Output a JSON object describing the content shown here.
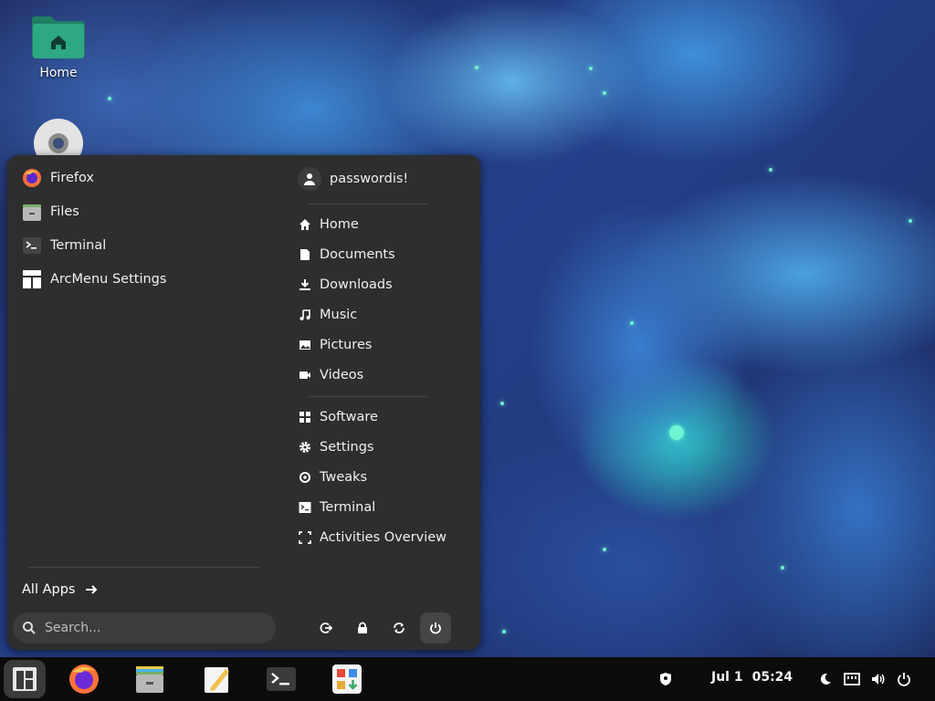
{
  "desktop": {
    "icons": [
      {
        "label": "Home",
        "icon": "home-folder-icon"
      },
      {
        "label": "",
        "icon": "disc-icon"
      }
    ]
  },
  "menu": {
    "apps": [
      {
        "label": "Firefox",
        "icon": "firefox-icon"
      },
      {
        "label": "Files",
        "icon": "files-icon"
      },
      {
        "label": "Terminal",
        "icon": "terminal-icon"
      },
      {
        "label": "ArcMenu Settings",
        "icon": "arcmenu-settings-icon"
      }
    ],
    "user": {
      "name": "passwordis!",
      "icon": "user-icon"
    },
    "places": [
      {
        "label": "Home",
        "icon": "home-icon"
      },
      {
        "label": "Documents",
        "icon": "document-icon"
      },
      {
        "label": "Downloads",
        "icon": "download-icon"
      },
      {
        "label": "Music",
        "icon": "music-icon"
      },
      {
        "label": "Pictures",
        "icon": "picture-icon"
      },
      {
        "label": "Videos",
        "icon": "video-icon"
      }
    ],
    "system": [
      {
        "label": "Software",
        "icon": "software-icon"
      },
      {
        "label": "Settings",
        "icon": "settings-gear-icon"
      },
      {
        "label": "Tweaks",
        "icon": "tweaks-icon"
      },
      {
        "label": "Terminal",
        "icon": "terminal-icon"
      },
      {
        "label": "Activities Overview",
        "icon": "activities-overview-icon"
      }
    ],
    "all_apps_label": "All Apps",
    "search_placeholder": "Search...",
    "power_buttons": [
      "logout-icon",
      "lock-icon",
      "restart-icon",
      "power-icon"
    ]
  },
  "taskbar": {
    "apps": [
      "menu-icon",
      "firefox-icon",
      "files-icon",
      "text-editor-icon",
      "terminal-icon",
      "software-center-icon"
    ],
    "date": "Jul 1",
    "time": "05:24",
    "tray": [
      "security-shield-icon",
      "night-light-icon",
      "network-icon",
      "volume-icon",
      "power-icon"
    ]
  },
  "colors": {
    "menu_bg": "#2e2e2e",
    "taskbar_bg": "#0c0c0c",
    "accent_green": "#2e9e7f"
  }
}
